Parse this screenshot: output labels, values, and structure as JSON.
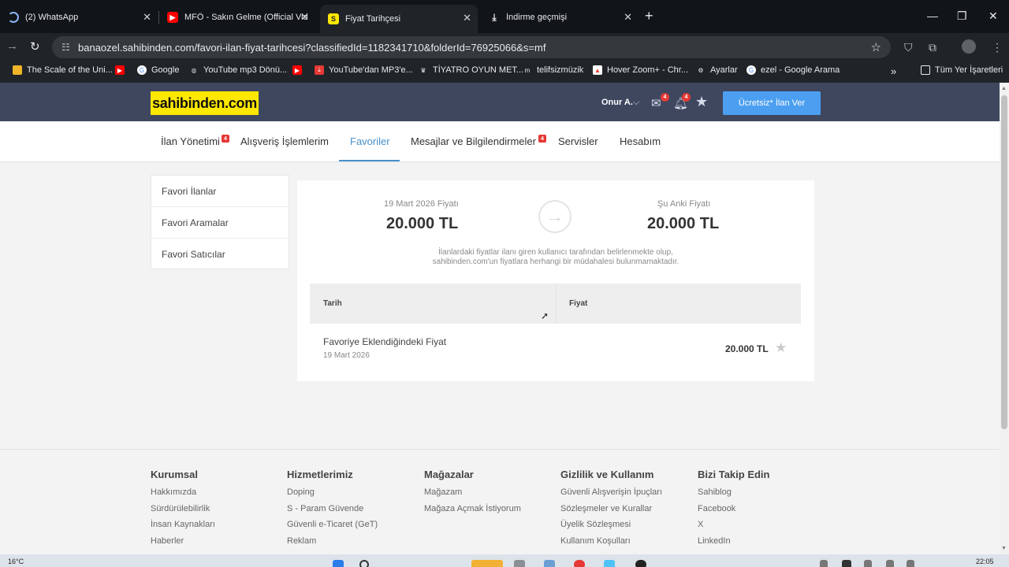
{
  "browser": {
    "tabs": [
      {
        "title": "(2) WhatsApp",
        "icon": "loading-icon"
      },
      {
        "title": "MFÖ - Sakın Gelme (Official Vid",
        "icon": "youtube-icon"
      },
      {
        "title": "Fiyat Tarihçesi",
        "icon": "sahibinden-favicon",
        "active": true
      },
      {
        "title": "İndirme geçmişi",
        "icon": "download-icon"
      }
    ],
    "url_host": "banaozel.sahibinden.com",
    "url_path": "/favori-ilan-fiyat-tarihcesi?classifiedId=1182341710&folderId=76925066&s=mf",
    "bookmarks": [
      "The Scale of the Uni...",
      "",
      "Google",
      "YouTube mp3 Dönü...",
      "",
      "YouTube'dan MP3'e...",
      "TİYATRO OYUN MET...",
      "telifsizmüzik",
      "Hover Zoom+ - Chr...",
      "Ayarlar",
      "ezel - Google Arama"
    ],
    "all_bookmarks": "Tüm Yer İşaretleri"
  },
  "header": {
    "logo": "sahibinden.com",
    "user": "Onur A.",
    "messages_badge": "4",
    "notifications_badge": "4",
    "cta": "Ücretsiz* İlan Ver"
  },
  "subnav": {
    "items": [
      "İlan Yönetimi",
      "Alışveriş İşlemlerim",
      "Favoriler",
      "Mesajlar ve Bilgilendirmeler",
      "Servisler",
      "Hesabım"
    ],
    "badge1": "4",
    "badge2": "4",
    "active": "Favoriler"
  },
  "sidebar": {
    "items": [
      "Favori İlanlar",
      "Favori Aramalar",
      "Favori Satıcılar"
    ]
  },
  "price": {
    "old_label": "19 Mart 2026 Fiyatı",
    "old_value": "20.000 TL",
    "new_label": "Şu Anki Fiyatı",
    "new_value": "20.000 TL",
    "disclaimer_line1": "İlanlardaki fiyatlar ilanı giren kullanıcı tarafından belirlenmekte olup,",
    "disclaimer_line2": "sahibinden.com'un fiyatlara herhangi bir müdahalesi bulunmamaktadır."
  },
  "table": {
    "col_date": "Tarih",
    "col_price": "Fiyat",
    "rows": [
      {
        "label": "Favoriye Eklendiğindeki Fiyat",
        "date": "19 Mart 2026",
        "price": "20.000 TL"
      }
    ]
  },
  "footer": {
    "columns": [
      {
        "title": "Kurumsal",
        "links": [
          "Hakkımızda",
          "Sürdürülebilirlik",
          "İnsan Kaynakları",
          "Haberler"
        ]
      },
      {
        "title": "Hizmetlerimiz",
        "links": [
          "Doping",
          "S - Param Güvende",
          "Güvenli e-Ticaret (GeT)",
          "Reklam"
        ]
      },
      {
        "title": "Mağazalar",
        "links": [
          "Mağazam",
          "Mağaza Açmak İstiyorum"
        ]
      },
      {
        "title": "Gizlilik ve Kullanım",
        "links": [
          "Güvenli Alışverişin İpuçları",
          "Sözleşmeler ve Kurallar",
          "Üyelik Sözleşmesi",
          "Kullanım Koşulları"
        ]
      },
      {
        "title": "Bizi Takip Edin",
        "links": [
          "Sahiblog",
          "Facebook",
          "X",
          "LinkedIn"
        ]
      }
    ]
  },
  "taskbar": {
    "temperature": "16°C",
    "time": "22:05"
  },
  "colors": {
    "header_bg": "#3f475f",
    "logo_bg": "#ffe800",
    "cta_bg": "#4c9ff0",
    "active_nav": "#4a90c8",
    "badge": "#e53935"
  }
}
